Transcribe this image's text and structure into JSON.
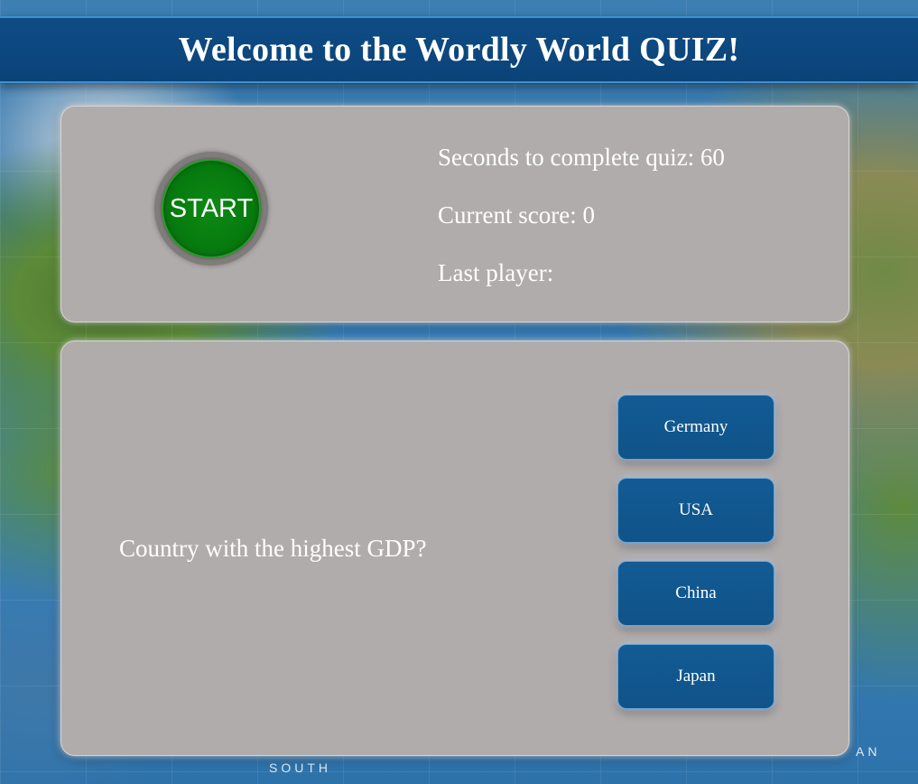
{
  "header": {
    "title": "Welcome to the Wordly World QUIZ!"
  },
  "top_panel": {
    "start_label": "START",
    "seconds_text": "Seconds to complete quiz: 60",
    "score_text": "Current score: 0",
    "last_player_text": "Last player:"
  },
  "quiz": {
    "question": "Country with the highest GDP?",
    "answers": [
      "Germany",
      "USA",
      "China",
      "Japan"
    ]
  },
  "background": {
    "map_labels": [
      "SOUTH",
      "AN"
    ]
  },
  "colors": {
    "header_bg": "#0f4c86",
    "panel_bg": "#b1acac",
    "start_button": "#067a0e",
    "answer_button": "#135b94"
  }
}
